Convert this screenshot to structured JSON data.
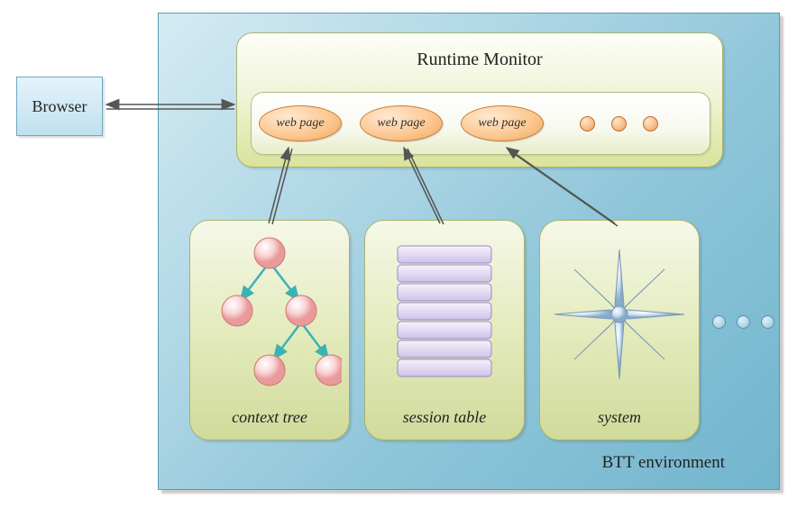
{
  "browser": {
    "label": "Browser"
  },
  "btt": {
    "label": "BTT environment"
  },
  "runtime": {
    "title": "Runtime Monitor",
    "pages": [
      "web page",
      "web page",
      "web page"
    ]
  },
  "sections": {
    "context": {
      "label": "context tree"
    },
    "session": {
      "label": "session table"
    },
    "system": {
      "label": "system"
    }
  }
}
